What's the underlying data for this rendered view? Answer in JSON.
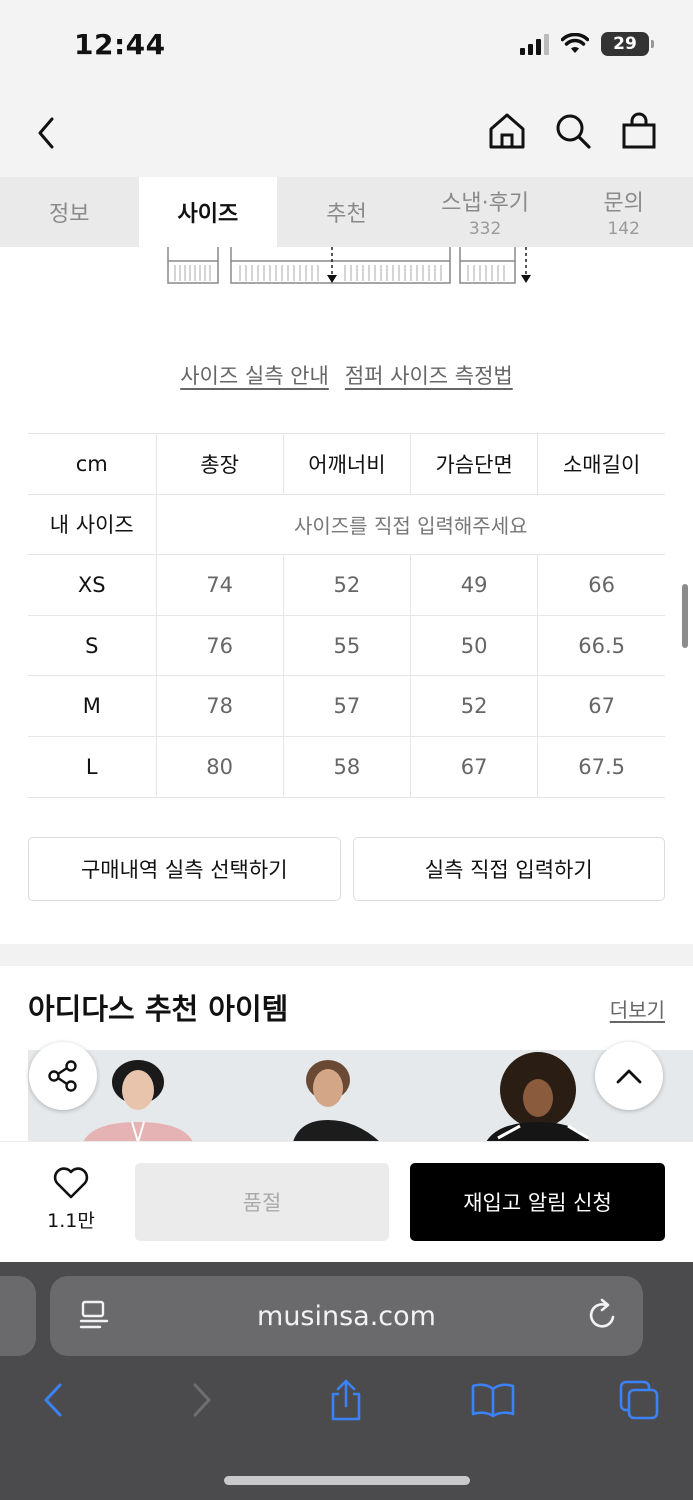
{
  "status": {
    "time": "12:44",
    "battery": "29"
  },
  "tabs": [
    {
      "label": "정보",
      "count": ""
    },
    {
      "label": "사이즈",
      "count": ""
    },
    {
      "label": "추천",
      "count": ""
    },
    {
      "label": "스냅·후기",
      "count": "332"
    },
    {
      "label": "문의",
      "count": "142"
    }
  ],
  "active_tab": "사이즈",
  "guide": {
    "size_guide_link": "사이즈 실측 안내",
    "measure_link": "점퍼 사이즈 측정법"
  },
  "size_table": {
    "headers": [
      "cm",
      "총장",
      "어깨너비",
      "가슴단면",
      "소매길이"
    ],
    "my_size_label": "내 사이즈",
    "my_size_placeholder": "사이즈를 직접 입력해주세요",
    "rows": [
      {
        "size": "XS",
        "values": [
          "74",
          "52",
          "49",
          "66"
        ]
      },
      {
        "size": "S",
        "values": [
          "76",
          "55",
          "50",
          "66.5"
        ]
      },
      {
        "size": "M",
        "values": [
          "78",
          "57",
          "52",
          "67"
        ]
      },
      {
        "size": "L",
        "values": [
          "80",
          "58",
          "67",
          "67.5"
        ]
      }
    ]
  },
  "actions": {
    "select_from_purchases": "구매내역 실측 선택하기",
    "enter_directly": "실측 직접 입력하기"
  },
  "recommend": {
    "title": "아디다스 추천 아이템",
    "more": "더보기"
  },
  "buy_bar": {
    "like_count": "1.1만",
    "sold_out": "품절",
    "restock_alert": "재입고 알림 신청"
  },
  "browser": {
    "url": "musinsa.com"
  },
  "colors": {
    "primary_button": "#000000",
    "disabled_button": "#ebebeb",
    "browser_chrome": "#4b4b4d",
    "link_blue": "#3b82f6"
  }
}
